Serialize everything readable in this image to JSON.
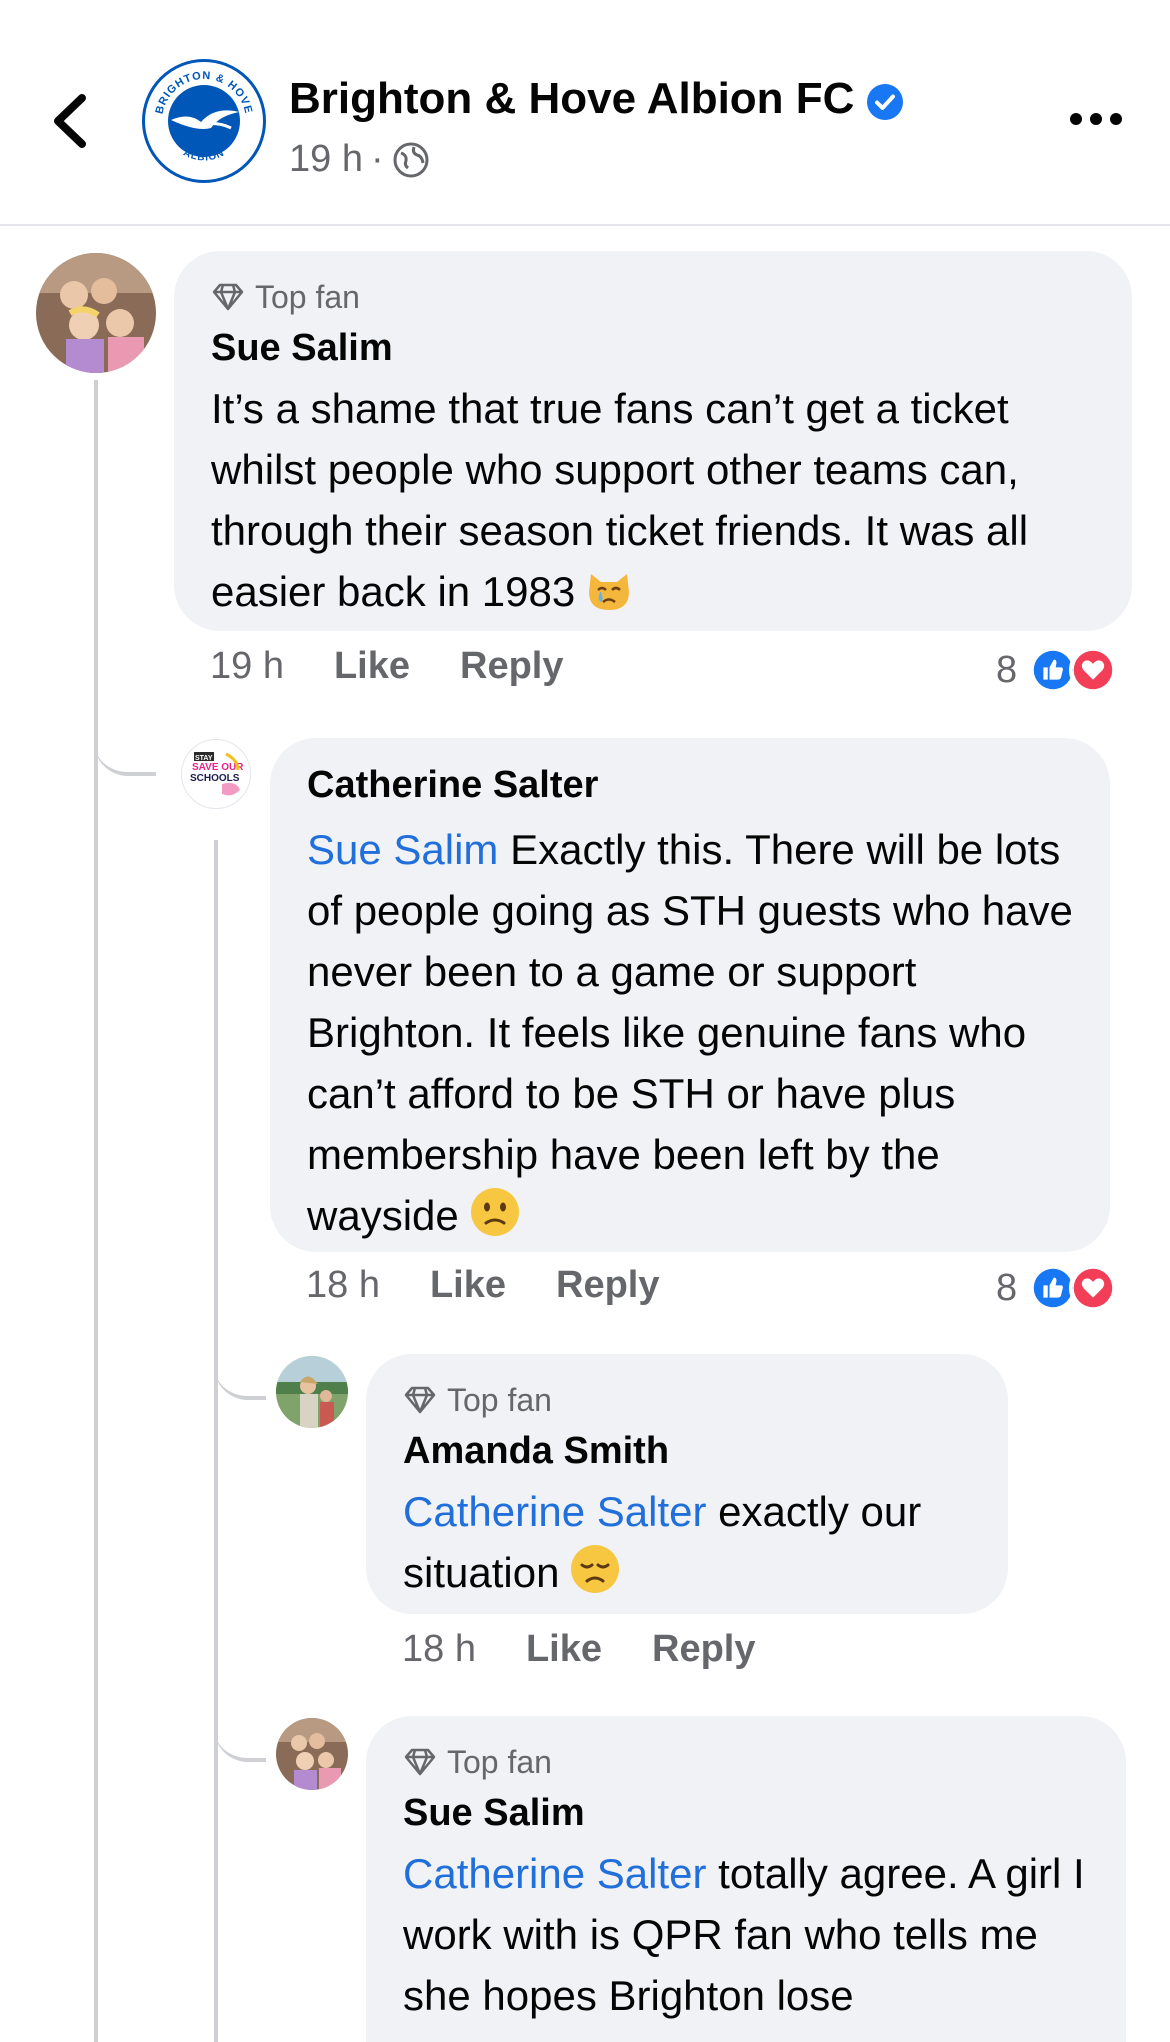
{
  "header": {
    "page_name": "Brighton & Hove Albion FC",
    "post_time": "19 h",
    "separator": "·",
    "icons": {
      "back": "chevron-left-icon",
      "verified": "verified-badge-icon",
      "audience": "globe-icon",
      "more": "more-dots-icon"
    },
    "logo_text_top": "BRIGHTON & HOVE",
    "logo_text_bottom": "ALBION"
  },
  "colors": {
    "link": "#216fdb",
    "bubble": "#f0f2f5",
    "secondary_text": "#65676b",
    "like": "#1877f2",
    "love": "#f33e58",
    "brand_blue": "#0057b8"
  },
  "comments": [
    {
      "badge": "Top fan",
      "author": "Sue Salim",
      "mention": "",
      "text": "It’s a shame that true fans can’t get a ticket whilst people who support other teams can, through their season ticket friends. It was all easier back in 1983",
      "emoji": "crying-cat-emoji",
      "time": "19 h",
      "like_label": "Like",
      "reply_label": "Reply",
      "reaction_count": "8"
    },
    {
      "badge": "",
      "author": "Catherine Salter",
      "mention": "Sue Salim",
      "text": "Exactly this. There will be lots of people going as STH guests who have never been to a game or support Brighton. It feels like genuine fans who can’t afford to be STH or have plus membership have been left by the wayside",
      "emoji": "slightly-frowning-emoji",
      "avatar_text": [
        "STAY UP!",
        "SAVE OUR",
        "SCHOOLS"
      ],
      "time": "18 h",
      "like_label": "Like",
      "reply_label": "Reply",
      "reaction_count": "8"
    },
    {
      "badge": "Top fan",
      "author": "Amanda Smith",
      "mention": "Catherine Salter",
      "text": "exactly our situation",
      "emoji": "disappointed-emoji",
      "time": "18 h",
      "like_label": "Like",
      "reply_label": "Reply"
    },
    {
      "badge": "Top fan",
      "author": "Sue Salim",
      "mention": "Catherine Salter",
      "text": "totally agree. A girl I work with is QPR fan who tells me she hopes Brighton lose"
    }
  ]
}
